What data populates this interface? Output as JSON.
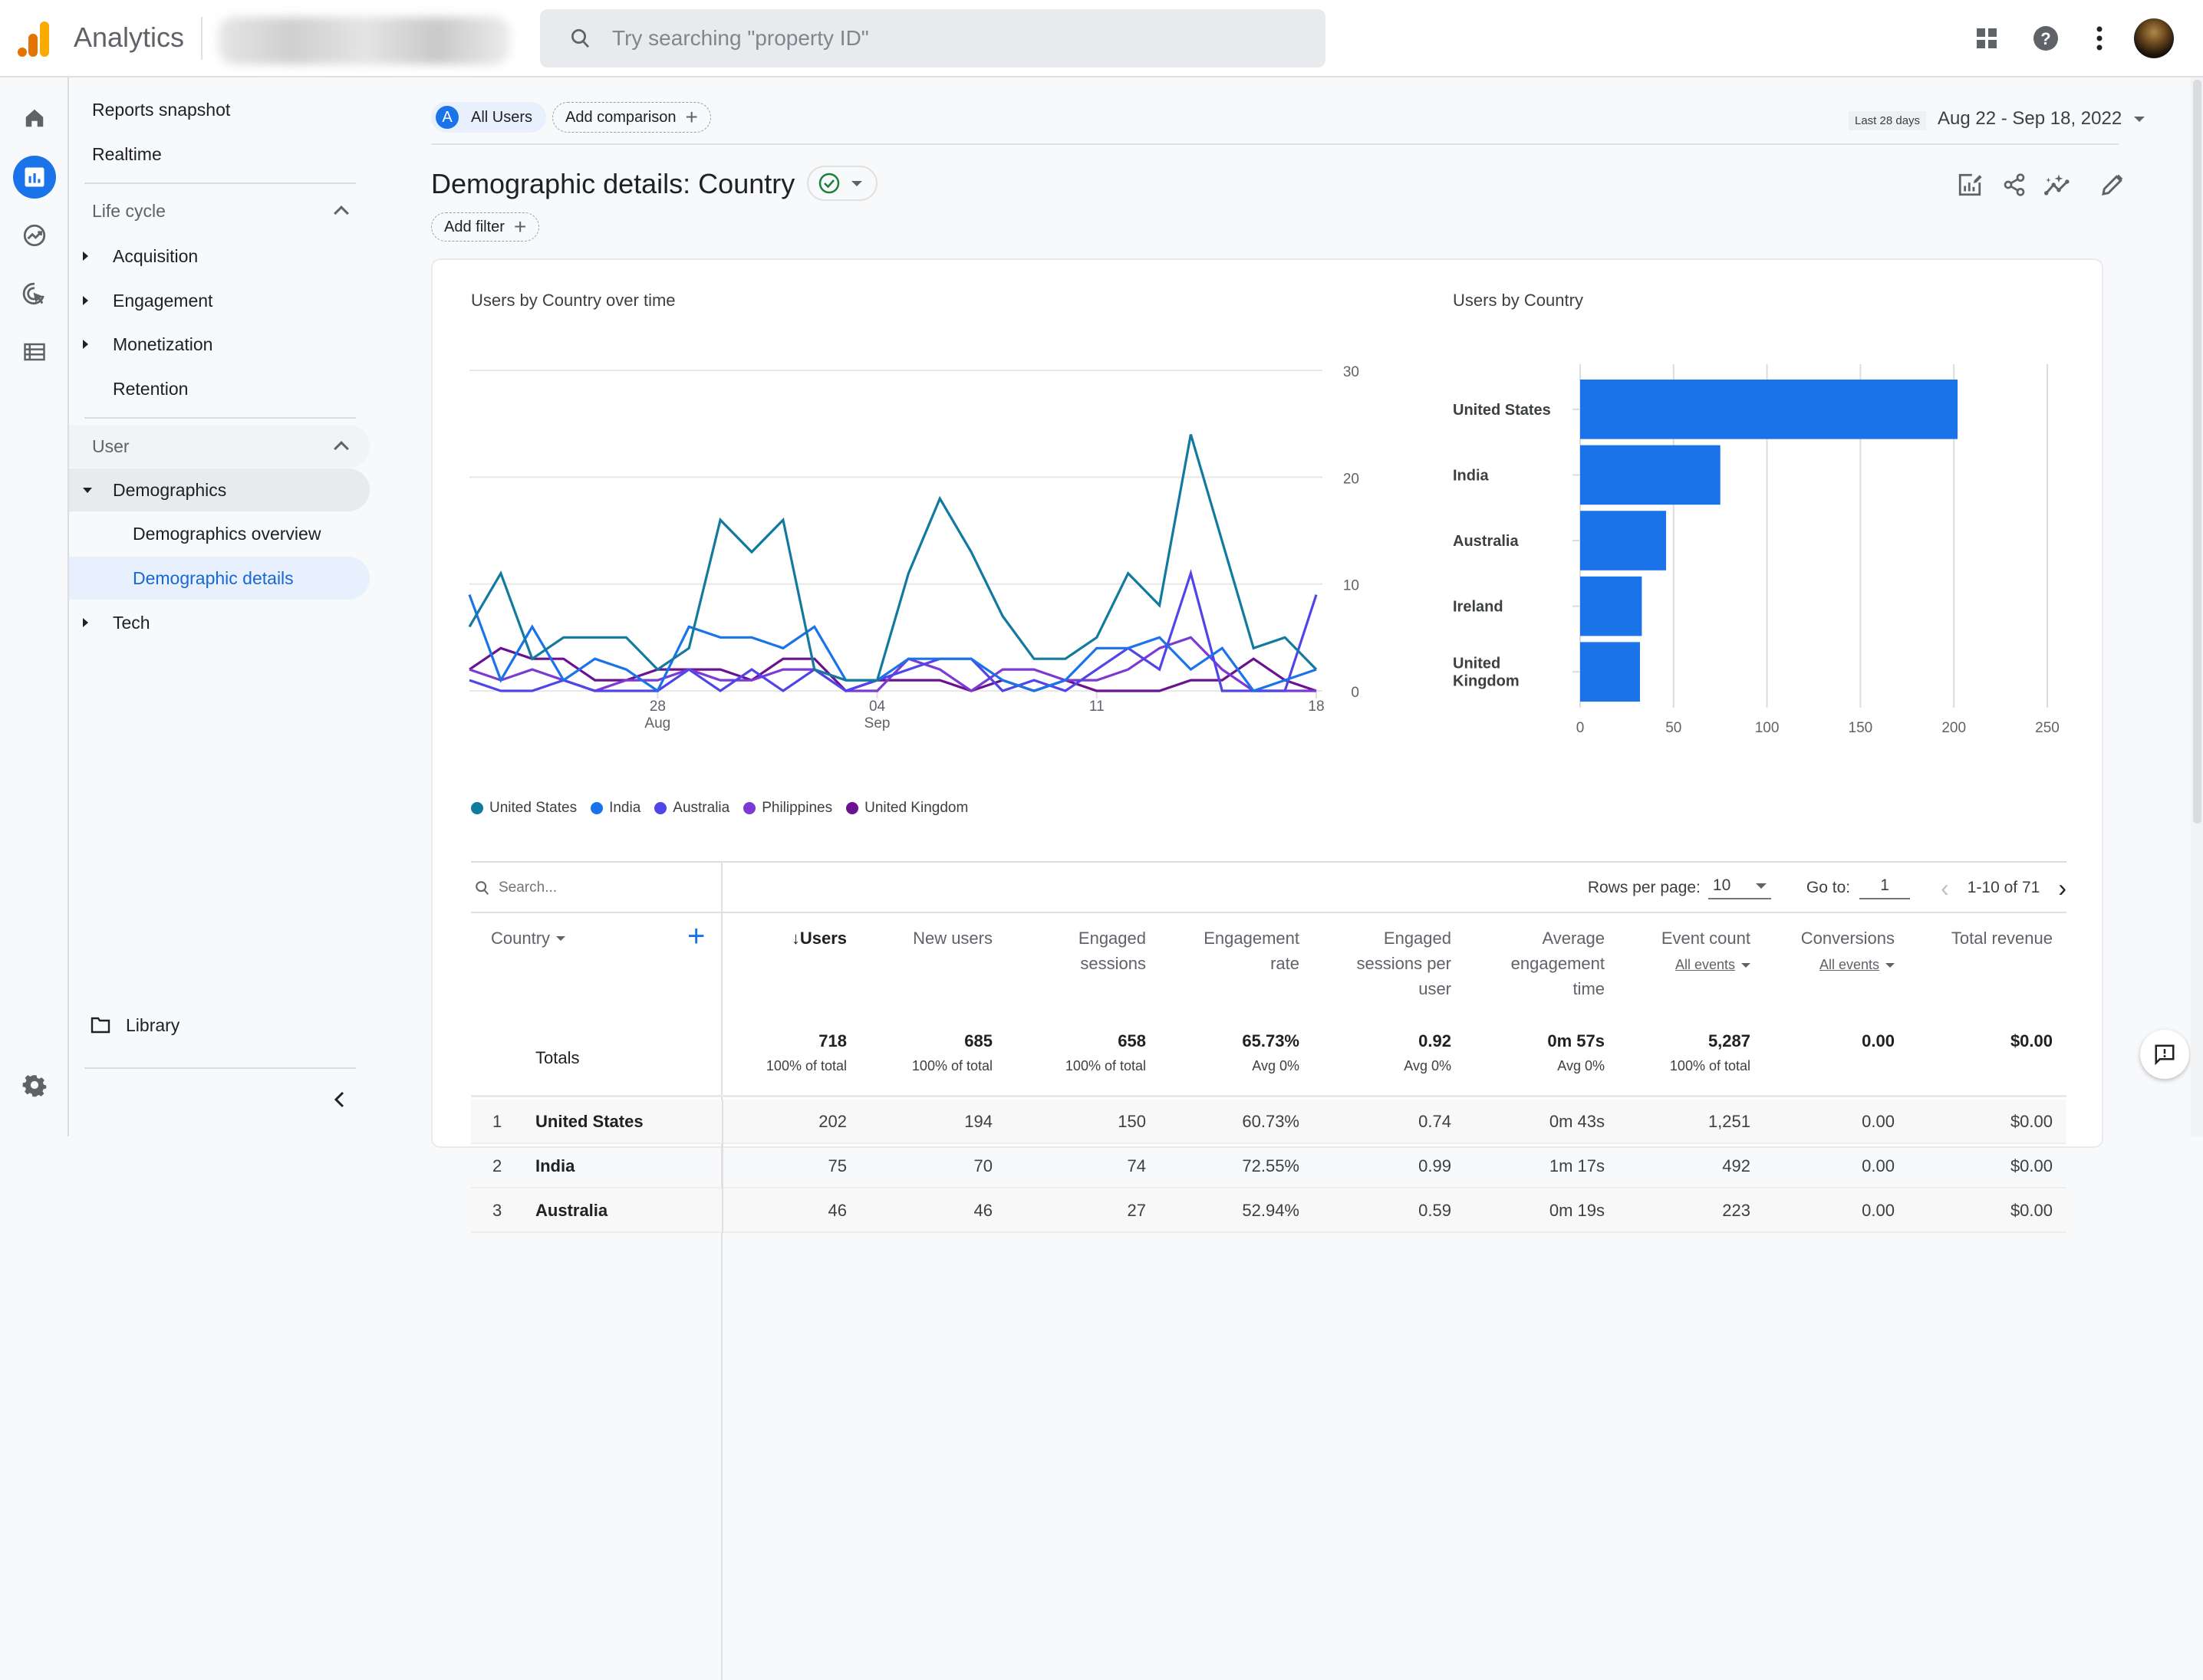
{
  "app": {
    "name": "Analytics",
    "search_placeholder": "Try searching \"property ID\"",
    "top_icons": [
      "apps-grid-icon",
      "help-icon",
      "more-vert-icon",
      "account-avatar"
    ]
  },
  "rail": {
    "icons": [
      "home-icon",
      "reports-icon",
      "explore-icon",
      "advertising-icon",
      "configure-icon"
    ],
    "active": "reports-icon",
    "bottom_icon": "settings-icon"
  },
  "nav": {
    "top_items": [
      "Reports snapshot",
      "Realtime"
    ],
    "sections": [
      {
        "title": "Life cycle",
        "expanded": true,
        "items": [
          {
            "label": "Acquisition",
            "expandable": true
          },
          {
            "label": "Engagement",
            "expandable": true
          },
          {
            "label": "Monetization",
            "expandable": true
          },
          {
            "label": "Retention",
            "expandable": false
          }
        ]
      },
      {
        "title": "User",
        "expanded": true,
        "items": [
          {
            "label": "Demographics",
            "expanded": true,
            "children": [
              "Demographics overview",
              "Demographic details"
            ]
          },
          {
            "label": "Tech",
            "expandable": true
          }
        ]
      }
    ],
    "active_item": "Demographic details",
    "library": "Library"
  },
  "comparison": {
    "segment_badge": "A",
    "segment_label": "All Users",
    "add_comparison": "Add comparison"
  },
  "date": {
    "preset": "Last 28 days",
    "range": "Aug 22 - Sep 18, 2022"
  },
  "page": {
    "title": "Demographic details: Country",
    "add_filter": "Add filter",
    "action_icons": [
      "customize-report-icon",
      "share-icon",
      "insights-icon",
      "edit-icon"
    ]
  },
  "colors": {
    "accent": "#1a73e8",
    "united_states": "#12799f",
    "india": "#1a73e8",
    "australia": "#4f45e8",
    "philippines": "#7b3ad4",
    "united_kingdom": "#6b1290",
    "bar": "#1a73e8"
  },
  "chart_data": [
    {
      "type": "line",
      "title": "Users by Country over time",
      "x": [
        "Aug 22",
        "Aug 23",
        "Aug 24",
        "Aug 25",
        "Aug 26",
        "Aug 27",
        "Aug 28",
        "Aug 29",
        "Aug 30",
        "Aug 31",
        "Sep 01",
        "Sep 02",
        "Sep 03",
        "Sep 04",
        "Sep 05",
        "Sep 06",
        "Sep 07",
        "Sep 08",
        "Sep 09",
        "Sep 10",
        "Sep 11",
        "Sep 12",
        "Sep 13",
        "Sep 14",
        "Sep 15",
        "Sep 16",
        "Sep 17",
        "Sep 18"
      ],
      "x_ticks": [
        {
          "index": 6,
          "label": "28",
          "sub": "Aug"
        },
        {
          "index": 13,
          "label": "04",
          "sub": "Sep"
        },
        {
          "index": 20,
          "label": "11",
          "sub": ""
        },
        {
          "index": 27,
          "label": "18",
          "sub": ""
        }
      ],
      "y_ticks": [
        0,
        10,
        20,
        30
      ],
      "ylim": [
        0,
        30
      ],
      "y_axis_side": "right",
      "grid": true,
      "legend_position": "bottom-left",
      "series": [
        {
          "name": "United States",
          "color": "#12799f",
          "values": [
            6,
            11,
            3,
            5,
            5,
            5,
            2,
            4,
            16,
            13,
            16,
            2,
            1,
            1,
            11,
            18,
            13,
            7,
            3,
            3,
            5,
            11,
            8,
            24,
            14,
            4,
            5,
            2
          ]
        },
        {
          "name": "India",
          "color": "#1a73e8",
          "values": [
            9,
            1,
            6,
            1,
            3,
            2,
            0,
            6,
            5,
            5,
            4,
            6,
            1,
            1,
            3,
            3,
            3,
            1,
            0,
            1,
            4,
            4,
            5,
            2,
            4,
            0,
            1,
            2
          ]
        },
        {
          "name": "Australia",
          "color": "#4f45e8",
          "values": [
            1,
            0,
            0,
            1,
            0,
            0,
            0,
            2,
            0,
            2,
            0,
            2,
            0,
            1,
            2,
            3,
            3,
            0,
            1,
            0,
            2,
            4,
            2,
            11,
            0,
            0,
            0,
            9
          ]
        },
        {
          "name": "Philippines",
          "color": "#7b3ad4",
          "values": [
            2,
            1,
            2,
            1,
            0,
            1,
            1,
            2,
            1,
            1,
            2,
            2,
            0,
            0,
            3,
            2,
            0,
            2,
            2,
            1,
            1,
            2,
            4,
            5,
            2,
            0,
            0,
            0
          ]
        },
        {
          "name": "United Kingdom",
          "color": "#6b1290",
          "values": [
            2,
            4,
            3,
            3,
            1,
            1,
            2,
            2,
            2,
            1,
            3,
            3,
            0,
            1,
            1,
            1,
            0,
            1,
            0,
            1,
            0,
            0,
            0,
            1,
            1,
            3,
            1,
            0
          ]
        }
      ]
    },
    {
      "type": "bar",
      "orientation": "horizontal",
      "title": "Users by Country",
      "categories": [
        "United States",
        "India",
        "Australia",
        "Ireland",
        "United Kingdom"
      ],
      "category_labels": [
        [
          "United States"
        ],
        [
          "India"
        ],
        [
          "Australia"
        ],
        [
          "Ireland"
        ],
        [
          "United",
          "Kingdom"
        ]
      ],
      "values": [
        202,
        75,
        46,
        33,
        32
      ],
      "x_ticks": [
        0,
        50,
        100,
        150,
        200,
        250
      ],
      "xlim": [
        0,
        250
      ],
      "grid": true
    }
  ],
  "table": {
    "search_placeholder": "Search...",
    "rows_per_page_label": "Rows per page:",
    "rows_per_page": "10",
    "goto_label": "Go to:",
    "goto_value": "1",
    "page_range": "1-10 of 71",
    "dimension_header": "Country",
    "columns": [
      {
        "lines": [
          "↓Users"
        ],
        "sorted": true
      },
      {
        "lines": [
          "New users"
        ]
      },
      {
        "lines": [
          "Engaged",
          "sessions"
        ]
      },
      {
        "lines": [
          "Engagement",
          "rate"
        ]
      },
      {
        "lines": [
          "Engaged",
          "sessions per",
          "user"
        ]
      },
      {
        "lines": [
          "Average",
          "engagement",
          "time"
        ]
      },
      {
        "lines": [
          "Event count"
        ],
        "sub": "All events"
      },
      {
        "lines": [
          "Conversions"
        ],
        "sub": "All events"
      },
      {
        "lines": [
          "Total revenue"
        ]
      }
    ],
    "totals_label": "Totals",
    "totals": [
      {
        "value": "718",
        "sub": "100% of total"
      },
      {
        "value": "685",
        "sub": "100% of total"
      },
      {
        "value": "658",
        "sub": "100% of total"
      },
      {
        "value": "65.73%",
        "sub": "Avg 0%"
      },
      {
        "value": "0.92",
        "sub": "Avg 0%"
      },
      {
        "value": "0m 57s",
        "sub": "Avg 0%"
      },
      {
        "value": "5,287",
        "sub": "100% of total"
      },
      {
        "value": "0.00",
        "sub": ""
      },
      {
        "value": "$0.00",
        "sub": ""
      }
    ],
    "rows": [
      {
        "index": "1",
        "country": "United States",
        "cells": [
          "202",
          "194",
          "150",
          "60.73%",
          "0.74",
          "0m 43s",
          "1,251",
          "0.00",
          "$0.00"
        ]
      },
      {
        "index": "2",
        "country": "India",
        "cells": [
          "75",
          "70",
          "74",
          "72.55%",
          "0.99",
          "1m 17s",
          "492",
          "0.00",
          "$0.00"
        ]
      },
      {
        "index": "3",
        "country": "Australia",
        "cells": [
          "46",
          "46",
          "27",
          "52.94%",
          "0.59",
          "0m 19s",
          "223",
          "0.00",
          "$0.00"
        ]
      }
    ]
  }
}
